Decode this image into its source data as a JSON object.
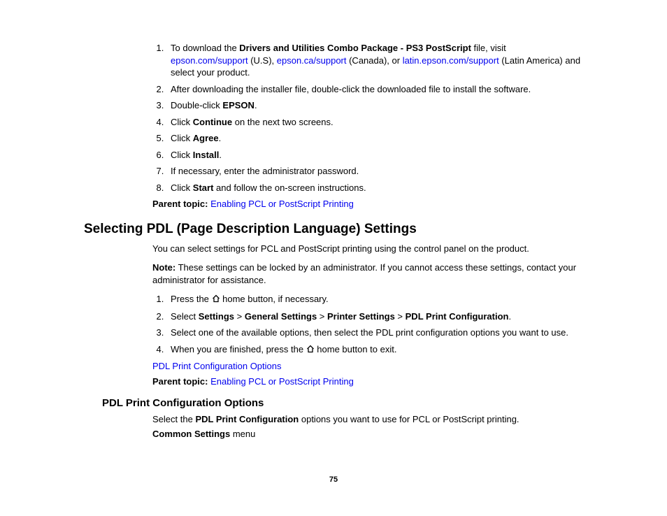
{
  "section1": {
    "steps": {
      "s1_a": "To download the ",
      "s1_b": "Drivers and Utilities Combo Package - PS3 PostScript",
      "s1_c": " file, visit ",
      "s1_link1": "epson.com/support",
      "s1_d": " (U.S), ",
      "s1_link2": "epson.ca/support",
      "s1_e": " (Canada), or ",
      "s1_link3": "latin.epson.com/support",
      "s1_f": " (Latin America) and select your product.",
      "s2": "After downloading the installer file, double-click the downloaded file to install the software.",
      "s3_a": "Double-click ",
      "s3_b": "EPSON",
      "s3_c": ".",
      "s4_a": "Click ",
      "s4_b": "Continue",
      "s4_c": " on the next two screens.",
      "s5_a": "Click ",
      "s5_b": "Agree",
      "s5_c": ".",
      "s6_a": "Click ",
      "s6_b": "Install",
      "s6_c": ".",
      "s7": "If necessary, enter the administrator password.",
      "s8_a": "Click ",
      "s8_b": "Start",
      "s8_c": " and follow the on-screen instructions."
    },
    "parent_label": "Parent topic: ",
    "parent_link": "Enabling PCL or PostScript Printing"
  },
  "section2": {
    "heading": "Selecting PDL (Page Description Language) Settings",
    "intro": "You can select settings for PCL and PostScript printing using the control panel on the product.",
    "note_label": "Note:",
    "note_text": " These settings can be locked by an administrator. If you cannot access these settings, contact your administrator for assistance.",
    "steps": {
      "s1_a": "Press the ",
      "s1_b": " home button, if necessary.",
      "s2_a": "Select ",
      "s2_b": "Settings",
      "s2_sep": " > ",
      "s2_c": "General Settings",
      "s2_d": "Printer Settings",
      "s2_e": "PDL Print Configuration",
      "s2_f": ".",
      "s3": "Select one of the available options, then select the PDL print configuration options you want to use.",
      "s4_a": "When you are finished, press the ",
      "s4_b": " home button to exit."
    },
    "link1": "PDL Print Configuration Options",
    "parent_label": "Parent topic: ",
    "parent_link": "Enabling PCL or PostScript Printing"
  },
  "section3": {
    "heading": "PDL Print Configuration Options",
    "p1_a": "Select the ",
    "p1_b": "PDL Print Configuration",
    "p1_c": " options you want to use for PCL or PostScript printing.",
    "p2_a": "Common Settings",
    "p2_b": " menu"
  },
  "page_number": "75"
}
